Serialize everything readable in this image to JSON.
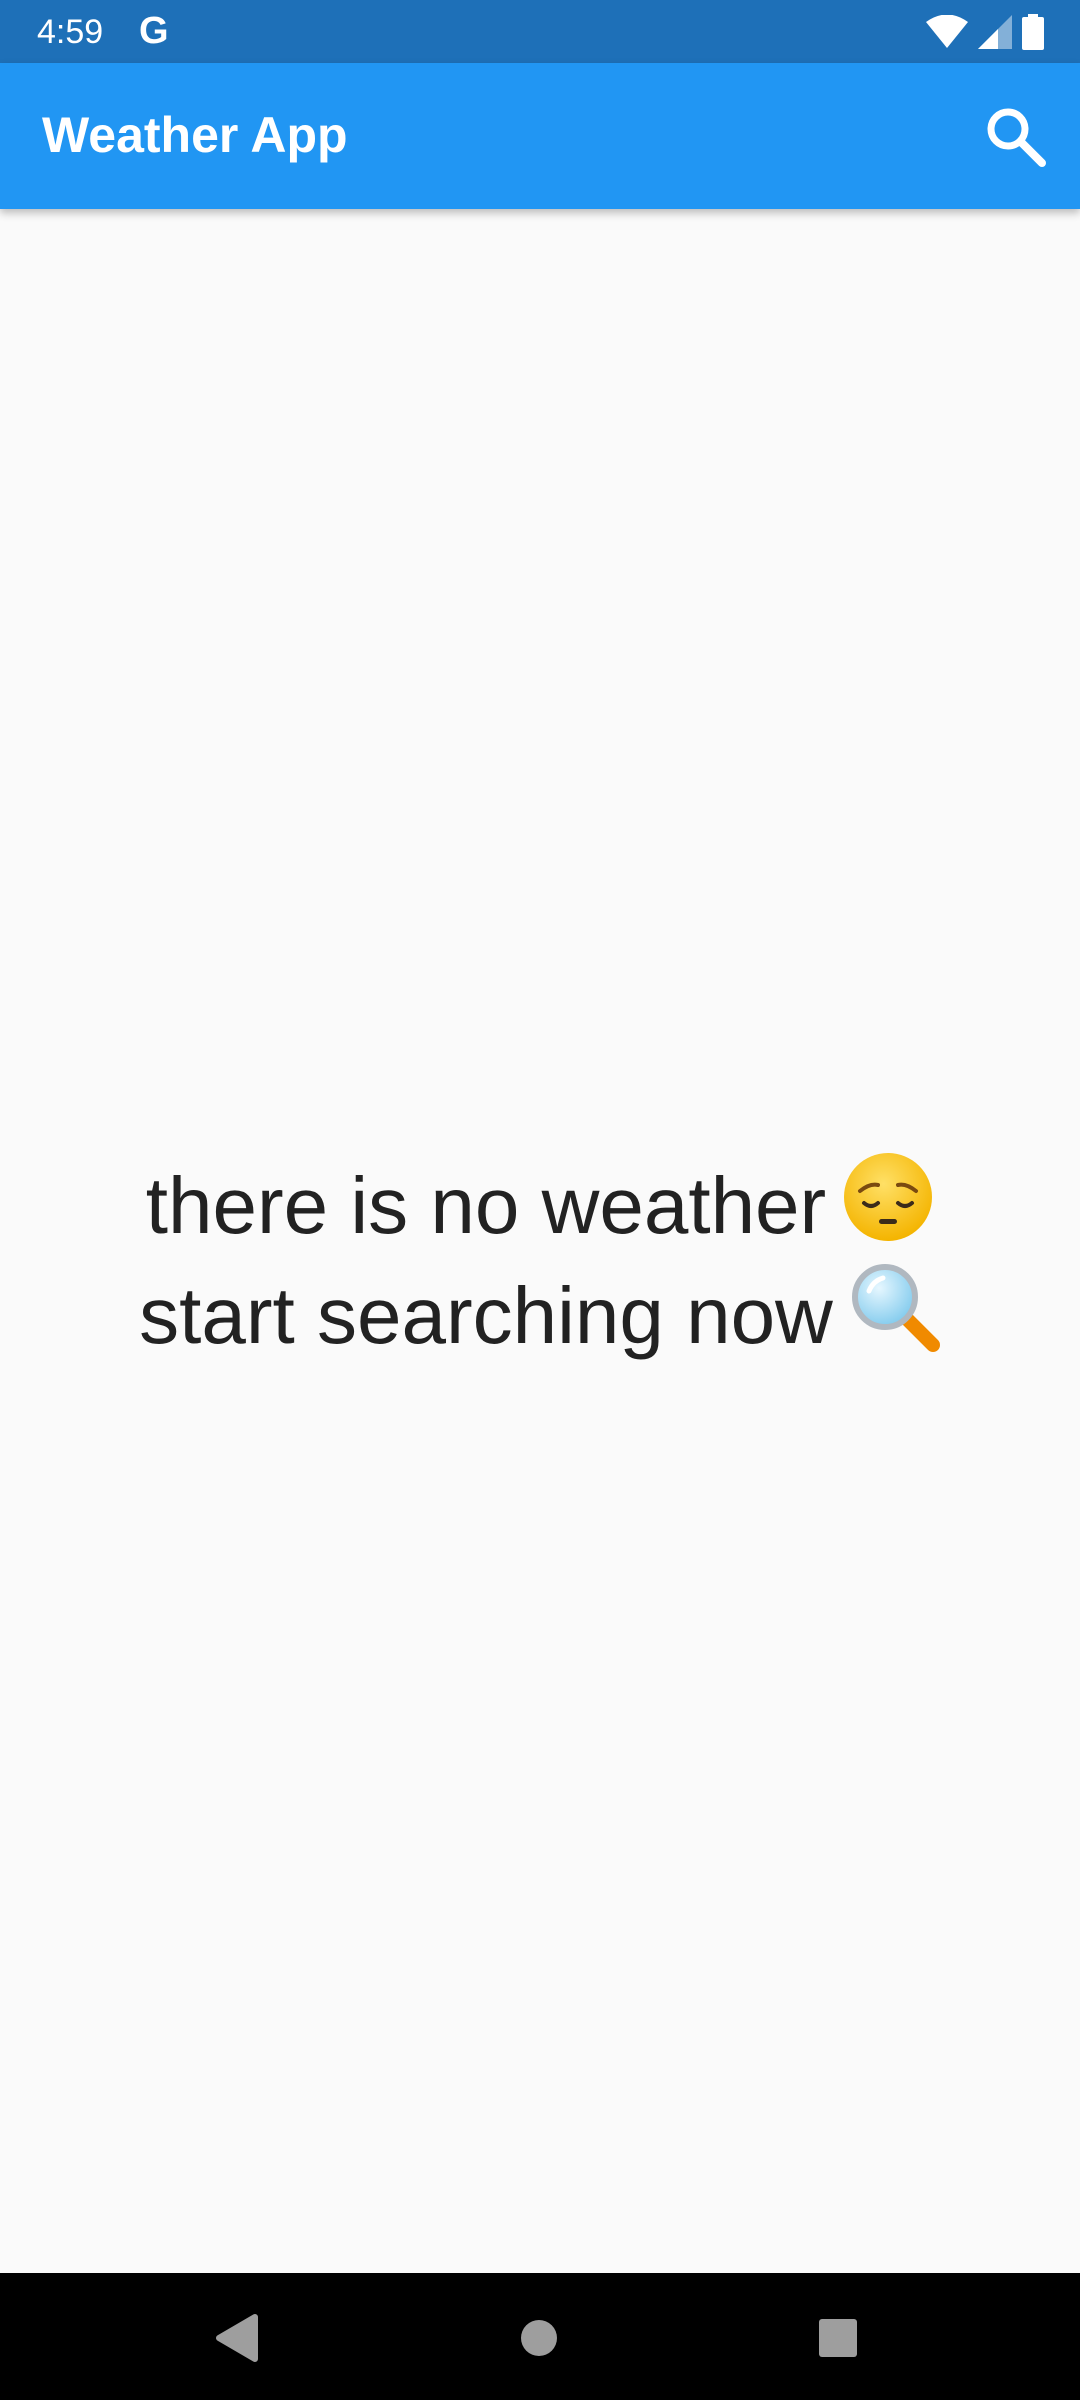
{
  "status_bar": {
    "time": "4:59",
    "g_badge": "G",
    "icons": [
      "wifi-icon",
      "cell-signal-icon",
      "battery-icon"
    ]
  },
  "app_bar": {
    "title": "Weather App",
    "action_icon": "search-icon",
    "color": "#2196f3"
  },
  "empty_state": {
    "line1": "there is no weather",
    "line1_emoji": "pensive-face-emoji",
    "line2": "start searching now",
    "line2_emoji": "magnifying-glass-emoji"
  },
  "nav_bar": {
    "buttons": [
      "back-icon",
      "home-icon",
      "recents-icon"
    ]
  },
  "colors": {
    "status_bar": "#1e70b8",
    "app_bar": "#2196f3",
    "background": "#fafafa",
    "text": "#222222"
  }
}
